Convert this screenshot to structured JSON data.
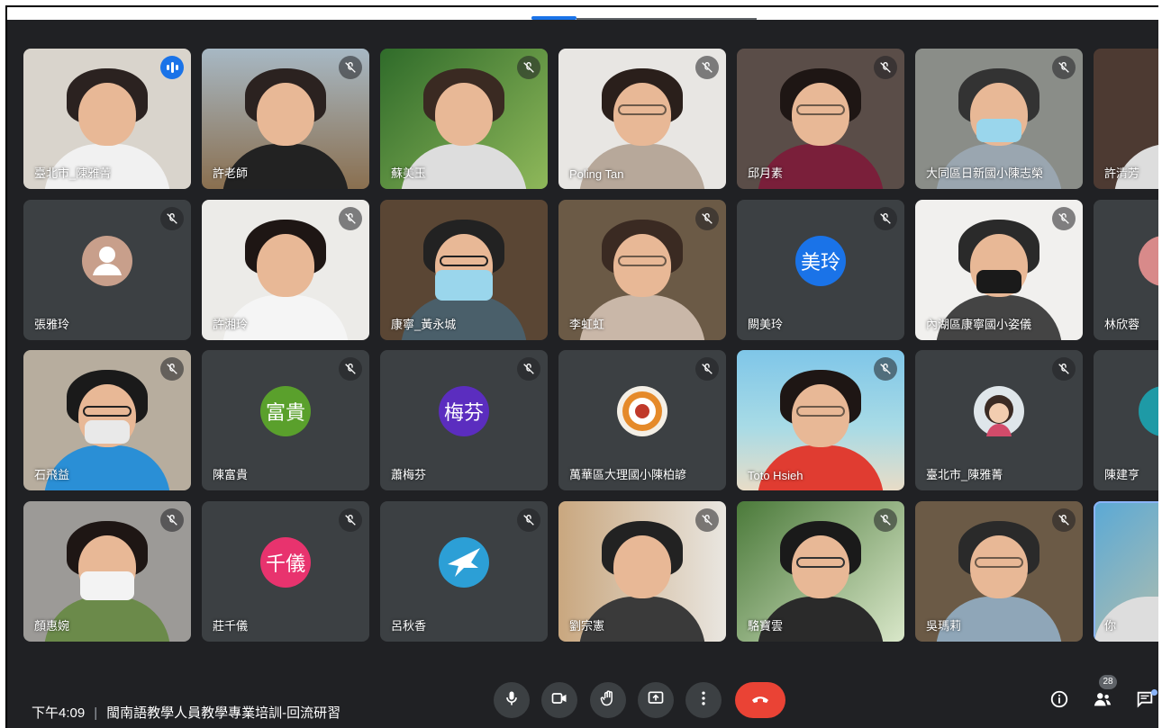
{
  "meeting": {
    "time": "下午4:09",
    "separator": "|",
    "title": "閩南語教學人員教學專業培訓-回流研習",
    "participant_count": "28"
  },
  "participants": [
    {
      "name": "臺北市_陳雅菁",
      "speaking": true
    },
    {
      "name": "許老師"
    },
    {
      "name": "蘇美玉"
    },
    {
      "name": "Poling Tan"
    },
    {
      "name": "邱月素"
    },
    {
      "name": "大同區日新國小陳志榮"
    },
    {
      "name": "許清芳"
    },
    {
      "name": "張雅玲"
    },
    {
      "name": "許湘玲"
    },
    {
      "name": "康寧_黃永城"
    },
    {
      "name": "李虹虹"
    },
    {
      "name": "闕美玲",
      "avatar_text": "美玲"
    },
    {
      "name": "內湖區康寧國小姿儀"
    },
    {
      "name": "林欣蓉"
    },
    {
      "name": "石飛益"
    },
    {
      "name": "陳富貴",
      "avatar_text": "富貴"
    },
    {
      "name": "蕭梅芬",
      "avatar_text": "梅芬"
    },
    {
      "name": "萬華區大理國小陳柏諺"
    },
    {
      "name": "Toto Hsieh"
    },
    {
      "name": "臺北市_陳雅菁"
    },
    {
      "name": "陳建亨"
    },
    {
      "name": "顏惠婉"
    },
    {
      "name": "莊千儀",
      "avatar_text": "千儀"
    },
    {
      "name": "呂秋香"
    },
    {
      "name": "劉宗憲"
    },
    {
      "name": "駱寶雲"
    },
    {
      "name": "吳瑪莉"
    },
    {
      "name": "你"
    }
  ],
  "colors": {
    "background": "#202124",
    "tile": "#3c4043",
    "hangup": "#ea4335",
    "accent": "#1a73e8",
    "avatar_mei_ling": "#1a73e8",
    "avatar_fu_gui": "#5aa02c",
    "avatar_mei_fen": "#5b2dbf",
    "avatar_qian_yi": "#e8336e"
  },
  "icons": {
    "mute": "mic-off-icon",
    "speaking": "audio-bars-icon",
    "controls": [
      "mic-icon",
      "camera-icon",
      "raise-hand-icon",
      "present-icon",
      "more-options-icon",
      "hangup-icon"
    ],
    "right": [
      "info-icon",
      "people-icon",
      "chat-icon"
    ]
  }
}
